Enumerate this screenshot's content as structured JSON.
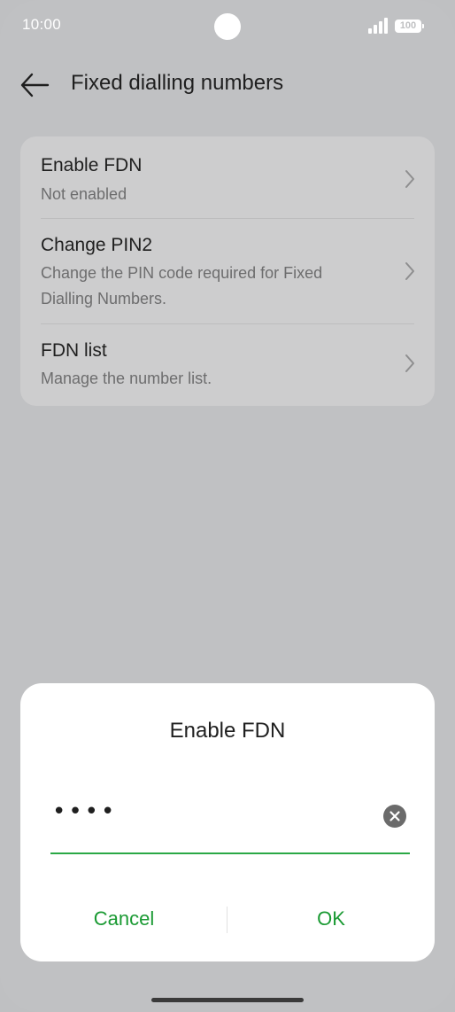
{
  "status_bar": {
    "time": "10:00",
    "battery": "100"
  },
  "header": {
    "title": "Fixed dialling numbers",
    "back_icon": "arrow-left-icon"
  },
  "settings": {
    "items": [
      {
        "title": "Enable FDN",
        "subtitle": "Not enabled"
      },
      {
        "title": "Change PIN2",
        "subtitle": "Change the PIN code required for Fixed Dialling Numbers."
      },
      {
        "title": "FDN list",
        "subtitle": "Manage the number list."
      }
    ]
  },
  "dialog": {
    "title": "Enable FDN",
    "input_value": "••••",
    "clear_icon": "clear-circle-icon",
    "cancel_label": "Cancel",
    "ok_label": "OK"
  },
  "colors": {
    "accent": "#1a9a33",
    "underline": "#2aa845",
    "scrim_background": "#c0c1c3",
    "card": "#cdcdce"
  }
}
